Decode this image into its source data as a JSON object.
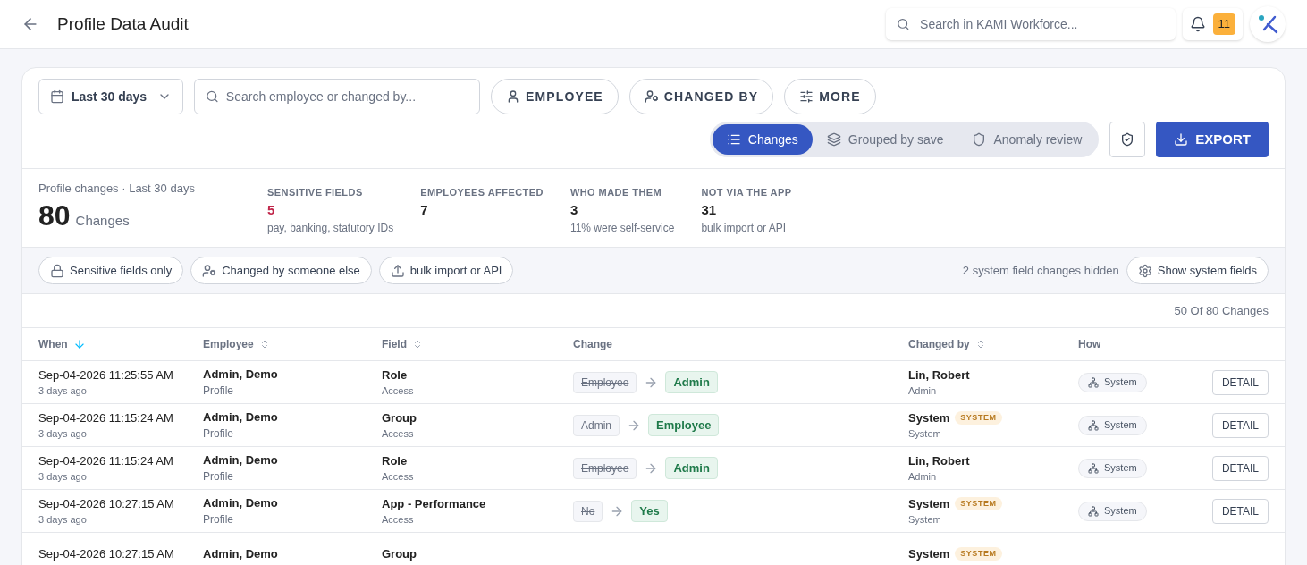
{
  "header": {
    "title": "Profile Data Audit",
    "search_placeholder": "Search in KAMI Workforce...",
    "notification_count": "11"
  },
  "filters": {
    "date_range": "Last 30 days",
    "search_placeholder": "Search employee or changed by...",
    "buttons": [
      {
        "label": "EMPLOYEE",
        "kind": "person"
      },
      {
        "label": "CHANGED BY",
        "kind": "person-shield"
      },
      {
        "label": "MORE",
        "kind": "sliders"
      }
    ]
  },
  "view_tabs": [
    {
      "label": "Changes",
      "kind": "list",
      "selected": true
    },
    {
      "label": "Grouped by save",
      "kind": "layers",
      "selected": false
    },
    {
      "label": "Anomaly review",
      "kind": "shield",
      "selected": false
    }
  ],
  "export_label": "EXPORT",
  "summary": {
    "caption": "Profile changes · Last 30 days",
    "total": "80",
    "unit": "Changes",
    "stats": [
      {
        "label": "SENSITIVE FIELDS",
        "value": "5",
        "note": "pay, banking, statutory IDs",
        "alert": true
      },
      {
        "label": "EMPLOYEES AFFECTED",
        "value": "7",
        "alert": false
      },
      {
        "label": "WHO MADE THEM",
        "value": "3",
        "note": "11% were self-service",
        "alert": false
      },
      {
        "label": "NOT VIA THE APP",
        "value": "31",
        "note": "bulk import or API",
        "alert": false
      }
    ]
  },
  "quick_filters": [
    {
      "label": "Sensitive fields only",
      "kind": "lock"
    },
    {
      "label": "Changed by someone else",
      "kind": "person-shield"
    },
    {
      "label": "bulk import or API",
      "kind": "upload"
    }
  ],
  "hidden_note": "2 system field changes hidden",
  "show_system_label": "Show system fields",
  "count": "50 Of 80 Changes",
  "table": {
    "columns": [
      {
        "label": "When",
        "sorted": true
      },
      {
        "label": "Employee",
        "sorted": false
      },
      {
        "label": "Field",
        "sorted": false
      },
      {
        "label": "Change"
      },
      {
        "label": "Changed by",
        "sorted": false
      },
      {
        "label": "How"
      }
    ],
    "rows": [
      {
        "when": "Sep-04-2026 11:25:55 AM",
        "ago": "3 days ago",
        "employee": "Admin, Demo",
        "employee_sub": "Profile",
        "field": "Role",
        "field_sub": "Access",
        "old": "Employee",
        "new": "Admin",
        "changed_by": "Lin, Robert",
        "changed_by_sub": "Admin",
        "how": "System",
        "action": "DETAIL"
      },
      {
        "when": "Sep-04-2026 11:15:24 AM",
        "ago": "3 days ago",
        "employee": "Admin, Demo",
        "employee_sub": "Profile",
        "field": "Group",
        "field_sub": "Access",
        "old": "Admin",
        "new": "Employee",
        "changed_by": "System",
        "badge": "SYSTEM",
        "changed_by_sub": "System",
        "how": "System",
        "action": "DETAIL"
      },
      {
        "when": "Sep-04-2026 11:15:24 AM",
        "ago": "3 days ago",
        "employee": "Admin, Demo",
        "employee_sub": "Profile",
        "field": "Role",
        "field_sub": "Access",
        "old": "Employee",
        "new": "Admin",
        "changed_by": "Lin, Robert",
        "changed_by_sub": "Admin",
        "how": "System",
        "action": "DETAIL"
      },
      {
        "when": "Sep-04-2026 10:27:15 AM",
        "ago": "3 days ago",
        "employee": "Admin, Demo",
        "employee_sub": "Profile",
        "field": "App - Performance",
        "field_sub": "Access",
        "old": "No",
        "new": "Yes",
        "changed_by": "System",
        "badge": "SYSTEM",
        "changed_by_sub": "System",
        "how": "System",
        "action": "DETAIL"
      },
      {
        "when": "Sep-04-2026 10:27:15 AM",
        "employee": "Admin, Demo",
        "field": "Group",
        "changed_by": "System",
        "badge": "SYSTEM"
      }
    ]
  }
}
